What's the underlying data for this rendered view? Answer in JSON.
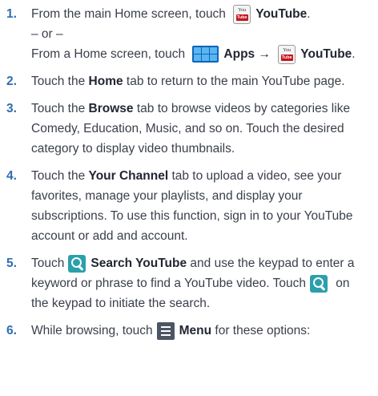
{
  "steps": [
    {
      "num": "1.",
      "lines": {
        "a_pre": "From the main Home screen, touch",
        "a_b": "YouTube",
        "a_post": ".",
        "or": "– or –",
        "c_pre": "From a Home screen, touch",
        "c_b1": "Apps",
        "c_arrow": "→",
        "c_b2": "YouTube",
        "c_post": "."
      }
    },
    {
      "num": "2.",
      "pre": "Touch the ",
      "b": "Home",
      "post": " tab to return to the main YouTube page."
    },
    {
      "num": "3.",
      "pre": "Touch the ",
      "b": "Browse",
      "l1": " tab to browse videos by categories like",
      "l2": "Comedy, Education, Music, and so on. Touch the desired",
      "l3": "category to display video thumbnails."
    },
    {
      "num": "4.",
      "pre": "Touch the ",
      "b": "Your Channel",
      "l1": " tab to upload a video, see your",
      "l2": "favorites, manage your playlists, and display your",
      "l3": "subscriptions. To use this function, sign in to your YouTube",
      "l4": "account or add and account."
    },
    {
      "num": "5.",
      "pre": "Touch",
      "b": "Search YouTube",
      "l1": " and use the keypad to enter a",
      "l2": "keyword or phrase to find a YouTube video. Touch",
      "l2b": " on",
      "l3": "the keypad to initiate the search."
    },
    {
      "num": "6.",
      "pre": "While browsing, touch",
      "b": "Menu",
      "post": " for these options:"
    }
  ],
  "icons": {
    "youtube_top": "You",
    "youtube_bottom": "Tube",
    "apps": "apps-grid-icon",
    "search": "search-icon",
    "menu": "menu-icon"
  },
  "colors": {
    "number": "#2f6db0",
    "search_icon_bg": "#2aa0ab",
    "youtube_red": "#c5141b",
    "apps_blue": "#0e64b8"
  }
}
